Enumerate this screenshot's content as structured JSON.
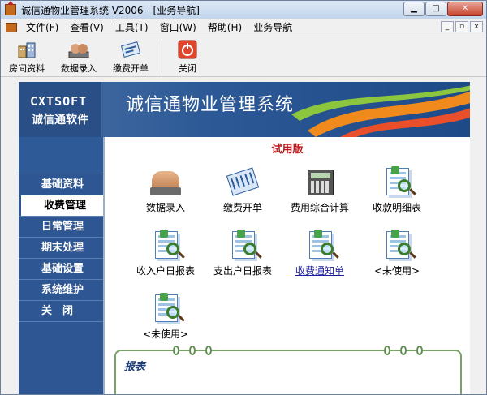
{
  "window": {
    "title": "诚信通物业管理系统 V2006 - [业务导航]",
    "controls": {
      "minimize": "▁",
      "maximize": "□",
      "close": "✕"
    }
  },
  "menubar": {
    "items": [
      "文件(F)",
      "查看(V)",
      "工具(T)",
      "窗口(W)",
      "帮助(H)",
      "业务导航"
    ],
    "mdi_controls": {
      "minimize": "_",
      "restore": "▫",
      "close": "x"
    }
  },
  "toolbar": {
    "buttons": [
      {
        "label": "房间资料",
        "icon": "building-icon"
      },
      {
        "label": "数据录入",
        "icon": "typing-hands-icon"
      },
      {
        "label": "缴费开单",
        "icon": "card-icon"
      },
      {
        "label": "关闭",
        "icon": "power-icon"
      }
    ]
  },
  "banner": {
    "brand_en": "CXTSOFT",
    "brand_cn": "诚信通软件",
    "title": "诚信通物业管理系统"
  },
  "sidebar": {
    "items": [
      "基础资料",
      "收费管理",
      "日常管理",
      "期末处理",
      "基础设置",
      "系统维护",
      "关　闭"
    ],
    "active_index": 1
  },
  "main": {
    "trial_label": "试用版",
    "tiles": [
      {
        "label": "数据录入",
        "icon": "typing-hands-icon"
      },
      {
        "label": "缴费开单",
        "icon": "card-icon"
      },
      {
        "label": "费用综合计算",
        "icon": "calculator-icon"
      },
      {
        "label": "收款明细表",
        "icon": "report-icon"
      },
      {
        "label": "收入户日报表",
        "icon": "report-icon"
      },
      {
        "label": "支出户日报表",
        "icon": "report-icon"
      },
      {
        "label": "收费通知单",
        "icon": "report-icon"
      },
      {
        "label": "<未使用>",
        "icon": "report-icon"
      },
      {
        "label": "<未使用>",
        "icon": "report-icon"
      }
    ],
    "report_section_title": "报表"
  }
}
